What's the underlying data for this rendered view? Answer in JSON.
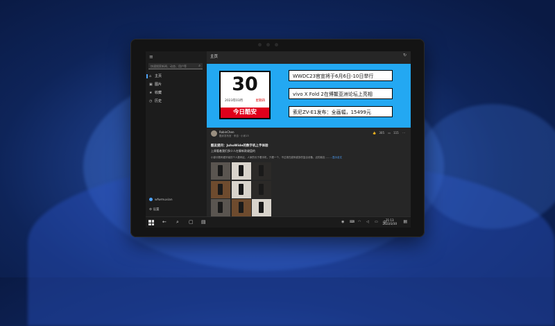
{
  "sidebar": {
    "menu_icon": "hamburger-icon",
    "search_placeholder": "快速搜索新闻、动态、用户等",
    "items": [
      {
        "label": "主页",
        "icon": "home-icon",
        "active": true
      },
      {
        "label": "图片",
        "icon": "image-icon",
        "active": false
      },
      {
        "label": "收藏",
        "icon": "star-icon",
        "active": false
      },
      {
        "label": "历史",
        "icon": "history-icon",
        "active": false
      }
    ],
    "user": "wfwmuxian",
    "settings": "设置"
  },
  "main": {
    "title": "主页",
    "banner": {
      "day": "30",
      "date": "2023年03月",
      "weekday": "星期四",
      "footer": "今日酷安",
      "headlines": [
        "WWDC23官宣将于6月6日-10日举行",
        "vivo X Fold 2在博鳌亚洲论坛上亮相",
        "索尼ZV-E1发布：全画幅，15499元"
      ]
    },
    "post": {
      "author": "RobinChen",
      "subtitle": "酷安发布官 · 来自 · 小米13",
      "likes": "305",
      "comments": "115",
      "title": "酷友提问：JuhoWide的数字机上手体验",
      "lead": "上周看着我们多少人在聊新款键盘的",
      "body": "小部分数码爱好者的个人数码区，人家的长于看手机，只看一个，不过现在越来越多的复合设备，近的朋友……",
      "more": "…显示全文"
    }
  },
  "taskbar": {
    "time": "21:13",
    "date": "2023/3/30",
    "lang": "中"
  }
}
